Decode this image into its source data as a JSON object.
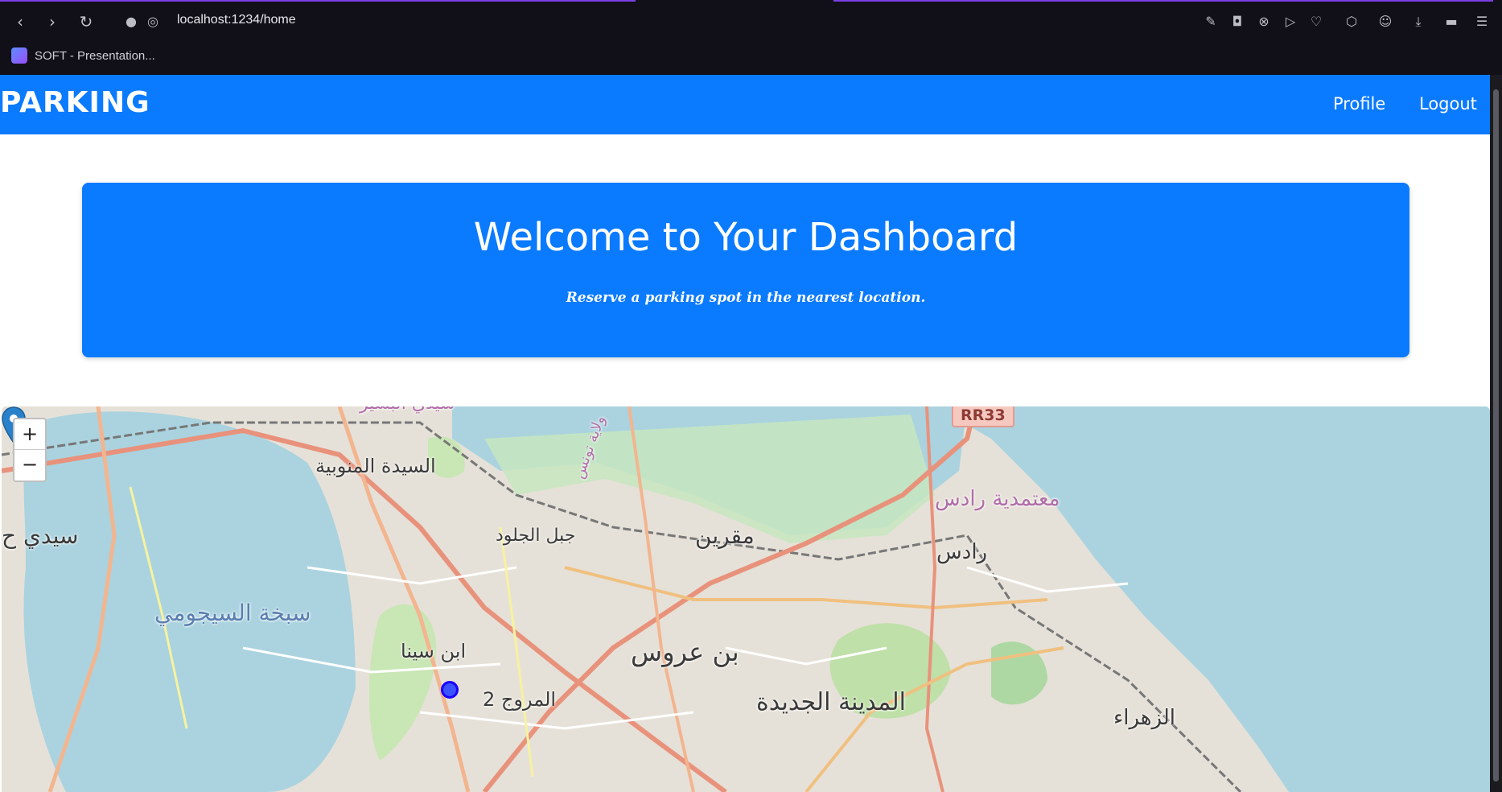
{
  "browser": {
    "url": "localhost:1234/home",
    "bookmark_label": "SOFT - Presentation..."
  },
  "navbar": {
    "brand": "PARKING",
    "links": [
      "Profile",
      "Logout"
    ]
  },
  "hero": {
    "title": "Welcome to Your Dashboard",
    "subtitle": "Reserve a parking spot in the nearest location."
  },
  "map": {
    "zoom_in": "+",
    "zoom_out": "−",
    "road_ref": "RR33",
    "labels": [
      "السيدة المنوبية",
      "جبل الجلود",
      "مقرين",
      "معتمدية رادس",
      "رادس",
      "سيدي ح",
      "سبخة السيجومي",
      "ابن سينا",
      "بن عروس",
      "المروج 2",
      "المدينة الجديدة",
      "الزهراء",
      "سيدي البشير",
      "ولاية تونس"
    ]
  },
  "colors": {
    "primary": "#0a7aff",
    "water": "#aad3df",
    "chrome": "#111018"
  }
}
